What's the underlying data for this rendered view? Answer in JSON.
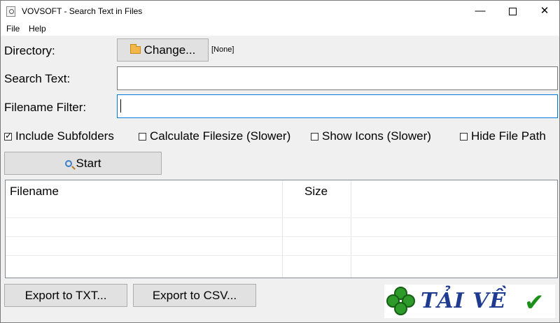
{
  "window": {
    "title": "VOVSOFT - Search Text in Files"
  },
  "title_buttons": {
    "minimize": "—",
    "close": "✕"
  },
  "menu": {
    "file": "File",
    "help": "Help"
  },
  "directory": {
    "label": "Directory:",
    "change_button": "Change...",
    "value": "[None]"
  },
  "search_text": {
    "label": "Search Text:",
    "value": ""
  },
  "filename_filter": {
    "label": "Filename Filter:",
    "value": ""
  },
  "options": {
    "include_subfolders": {
      "label": "Include Subfolders",
      "checked": true
    },
    "calculate_filesize": {
      "label": "Calculate Filesize (Slower)",
      "checked": false
    },
    "show_icons": {
      "label": "Show Icons (Slower)",
      "checked": false
    },
    "hide_file_path": {
      "label": "Hide File Path",
      "checked": false
    }
  },
  "start_button": "Start",
  "results": {
    "columns": [
      "Filename",
      "Size"
    ],
    "rows": []
  },
  "export": {
    "txt": "Export to TXT...",
    "csv": "Export to CSV..."
  },
  "watermark": {
    "text": "TẢI VỀ"
  },
  "icons": [
    "app-icon",
    "folder-icon",
    "search-icon",
    "clover-icon",
    "checkmark-icon"
  ]
}
